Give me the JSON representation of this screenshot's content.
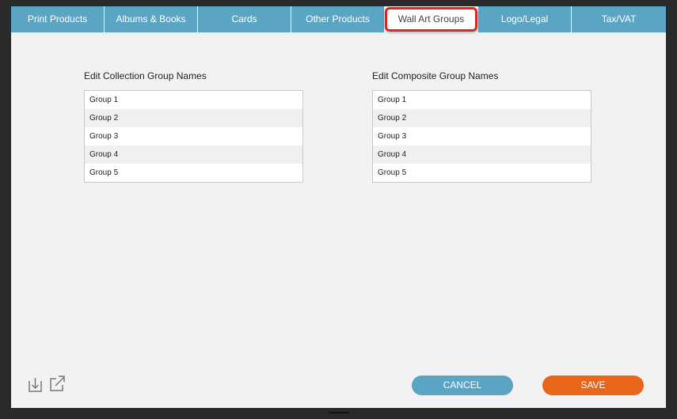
{
  "tabs": [
    {
      "label": "Print Products"
    },
    {
      "label": "Albums & Books"
    },
    {
      "label": "Cards"
    },
    {
      "label": "Other Products"
    },
    {
      "label": "Wall Art Groups"
    },
    {
      "label": "Logo/Legal"
    },
    {
      "label": "Tax/VAT"
    }
  ],
  "active_tab": "Wall Art Groups",
  "collection": {
    "heading": "Edit Collection Group Names",
    "items": [
      "Group 1",
      "Group 2",
      "Group 3",
      "Group 4",
      "Group 5"
    ]
  },
  "composite": {
    "heading": "Edit Composite Group Names",
    "items": [
      "Group 1",
      "Group 2",
      "Group 3",
      "Group 4",
      "Group 5"
    ]
  },
  "footer": {
    "import_icon": "import-icon",
    "export_icon": "export-icon",
    "cancel_label": "CANCEL",
    "save_label": "SAVE"
  },
  "colors": {
    "tab_bar": "#5aa5c4",
    "highlight": "#d42a22",
    "cancel": "#5aa5c4",
    "save": "#e9661b"
  }
}
